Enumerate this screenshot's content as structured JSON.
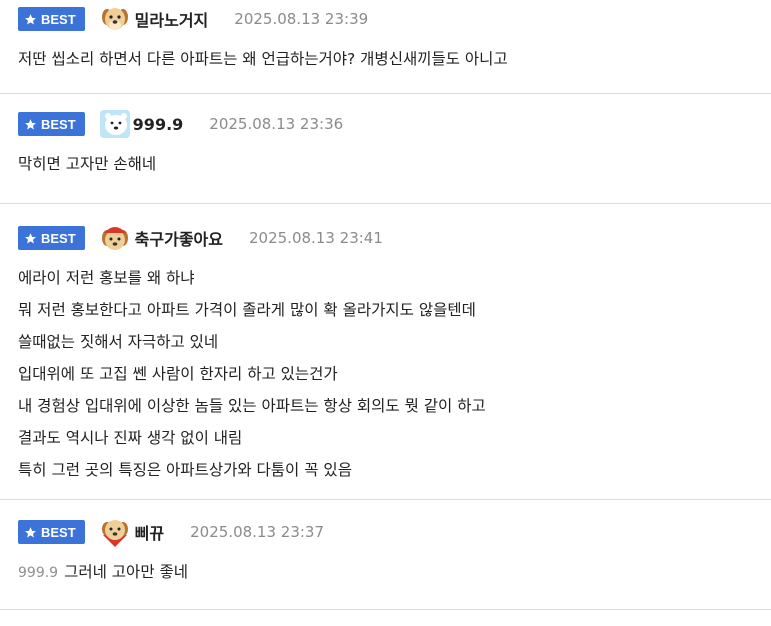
{
  "comments": [
    {
      "badge": "BEST",
      "nickname": "밀라노거지",
      "timestamp": "2025.08.13 23:39",
      "avatar": "puppy-icon",
      "lines": [
        "저딴 씹소리 하면서 다른 아파트는 왜 언급하는거야? 개병신새끼들도 아니고"
      ]
    },
    {
      "badge": "BEST",
      "nickname": "999.9",
      "timestamp": "2025.08.13 23:36",
      "avatar": "polar-bear-icon",
      "lines": [
        "막히면 고자만 손해네"
      ]
    },
    {
      "badge": "BEST",
      "nickname": "축구가좋아요",
      "timestamp": "2025.08.13 23:41",
      "avatar": "puppy-red-hat-icon",
      "lines": [
        "에라이 저런 홍보를 왜 하냐",
        "뭐 저런 홍보한다고 아파트 가격이 졸라게 많이 확 올라가지도 않을텐데",
        "쓸때없는 짓해서 자극하고 있네",
        "입대위에 또 고집 쎈 사람이 한자리 하고 있는건가",
        "내 경험상 입대위에 이상한 놈들 있는 아파트는 항상 회의도 뭣 같이 하고",
        "결과도 역시나 진짜 생각 없이 내림",
        "특히 그런 곳의 특징은 아파트상가와 다툼이 꼭 있음"
      ]
    },
    {
      "badge": "BEST",
      "nickname": "삐뀨",
      "timestamp": "2025.08.13 23:37",
      "avatar": "puppy-cape-icon",
      "reply_to": "999.9",
      "lines": [
        "그러네 고아만 좋네"
      ]
    }
  ],
  "colors": {
    "badge_bg": "#3c73d8",
    "divider": "#d9dde3",
    "timestamp": "#8b8b8b"
  }
}
